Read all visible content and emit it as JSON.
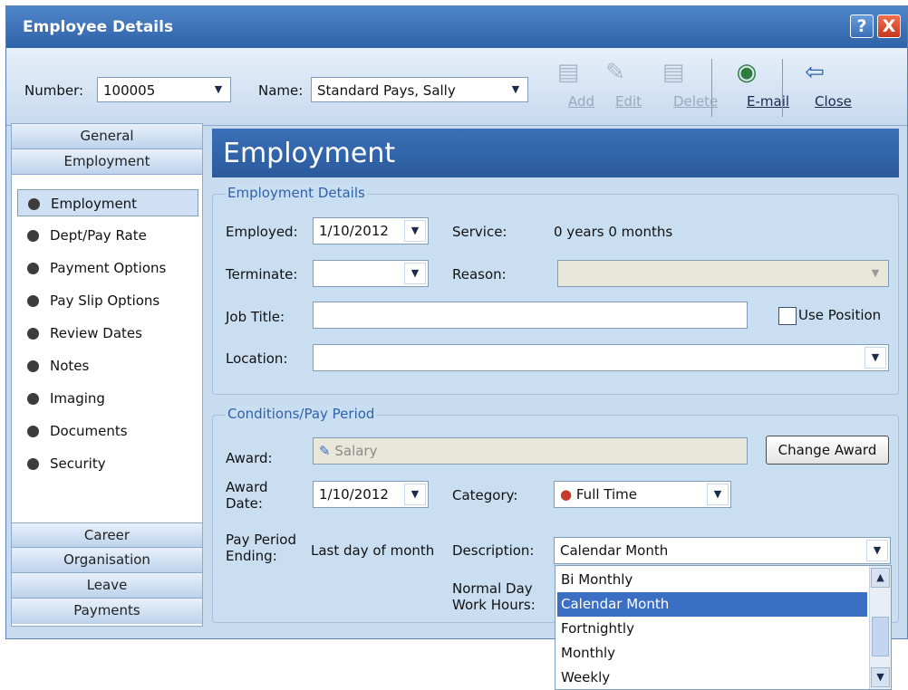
{
  "window": {
    "title": "Employee Details"
  },
  "titlebar": {
    "help": "?",
    "close": "X"
  },
  "toolbar": {
    "number_label": "Number:",
    "number_value": "100005",
    "name_label": "Name:",
    "name_value": "Standard Pays, Sally",
    "add": "Add",
    "edit": "Edit",
    "delete": "Delete",
    "email": "E-mail",
    "close": "Close"
  },
  "sidebar": {
    "top_headers": [
      "General",
      "Employment"
    ],
    "items": [
      "Employment",
      "Dept/Pay Rate",
      "Payment Options",
      "Pay Slip Options",
      "Review Dates",
      "Notes",
      "Imaging",
      "Documents",
      "Security"
    ],
    "selected": "Employment",
    "bottom_headers": [
      "Career",
      "Organisation",
      "Leave",
      "Payments"
    ]
  },
  "main": {
    "heading": "Employment",
    "employment_details": {
      "title": "Employment Details",
      "employed_label": "Employed:",
      "employed_value": "1/10/2012",
      "service_label": "Service:",
      "service_value": "0 years 0 months",
      "terminate_label": "Terminate:",
      "terminate_value": "",
      "reason_label": "Reason:",
      "reason_value": "",
      "job_title_label": "Job Title:",
      "job_title_value": "",
      "use_position_label": "Use Position",
      "location_label": "Location:",
      "location_value": ""
    },
    "conditions": {
      "title": "Conditions/Pay Period",
      "award_label": "Award:",
      "award_value": "Salary",
      "change_award_button": "Change Award",
      "award_date_label_1": "Award",
      "award_date_label_2": "Date:",
      "award_date_value": "1/10/2012",
      "category_label": "Category:",
      "category_value": "Full Time",
      "pay_period_label_1": "Pay Period",
      "pay_period_label_2": "Ending:",
      "pay_period_value": "Last day of month",
      "description_label": "Description:",
      "description_value": "Calendar Month",
      "normal_day_label_1": "Normal Day",
      "normal_day_label_2": "Work Hours:"
    },
    "description_dropdown": {
      "options": [
        "Bi Monthly",
        "Calendar Month",
        "Fortnightly",
        "Monthly",
        "Weekly"
      ],
      "selected": "Calendar Month"
    }
  },
  "colors": {
    "accent": "#2f62a8",
    "selection": "#3a6fc4",
    "panel": "#cadef2"
  }
}
